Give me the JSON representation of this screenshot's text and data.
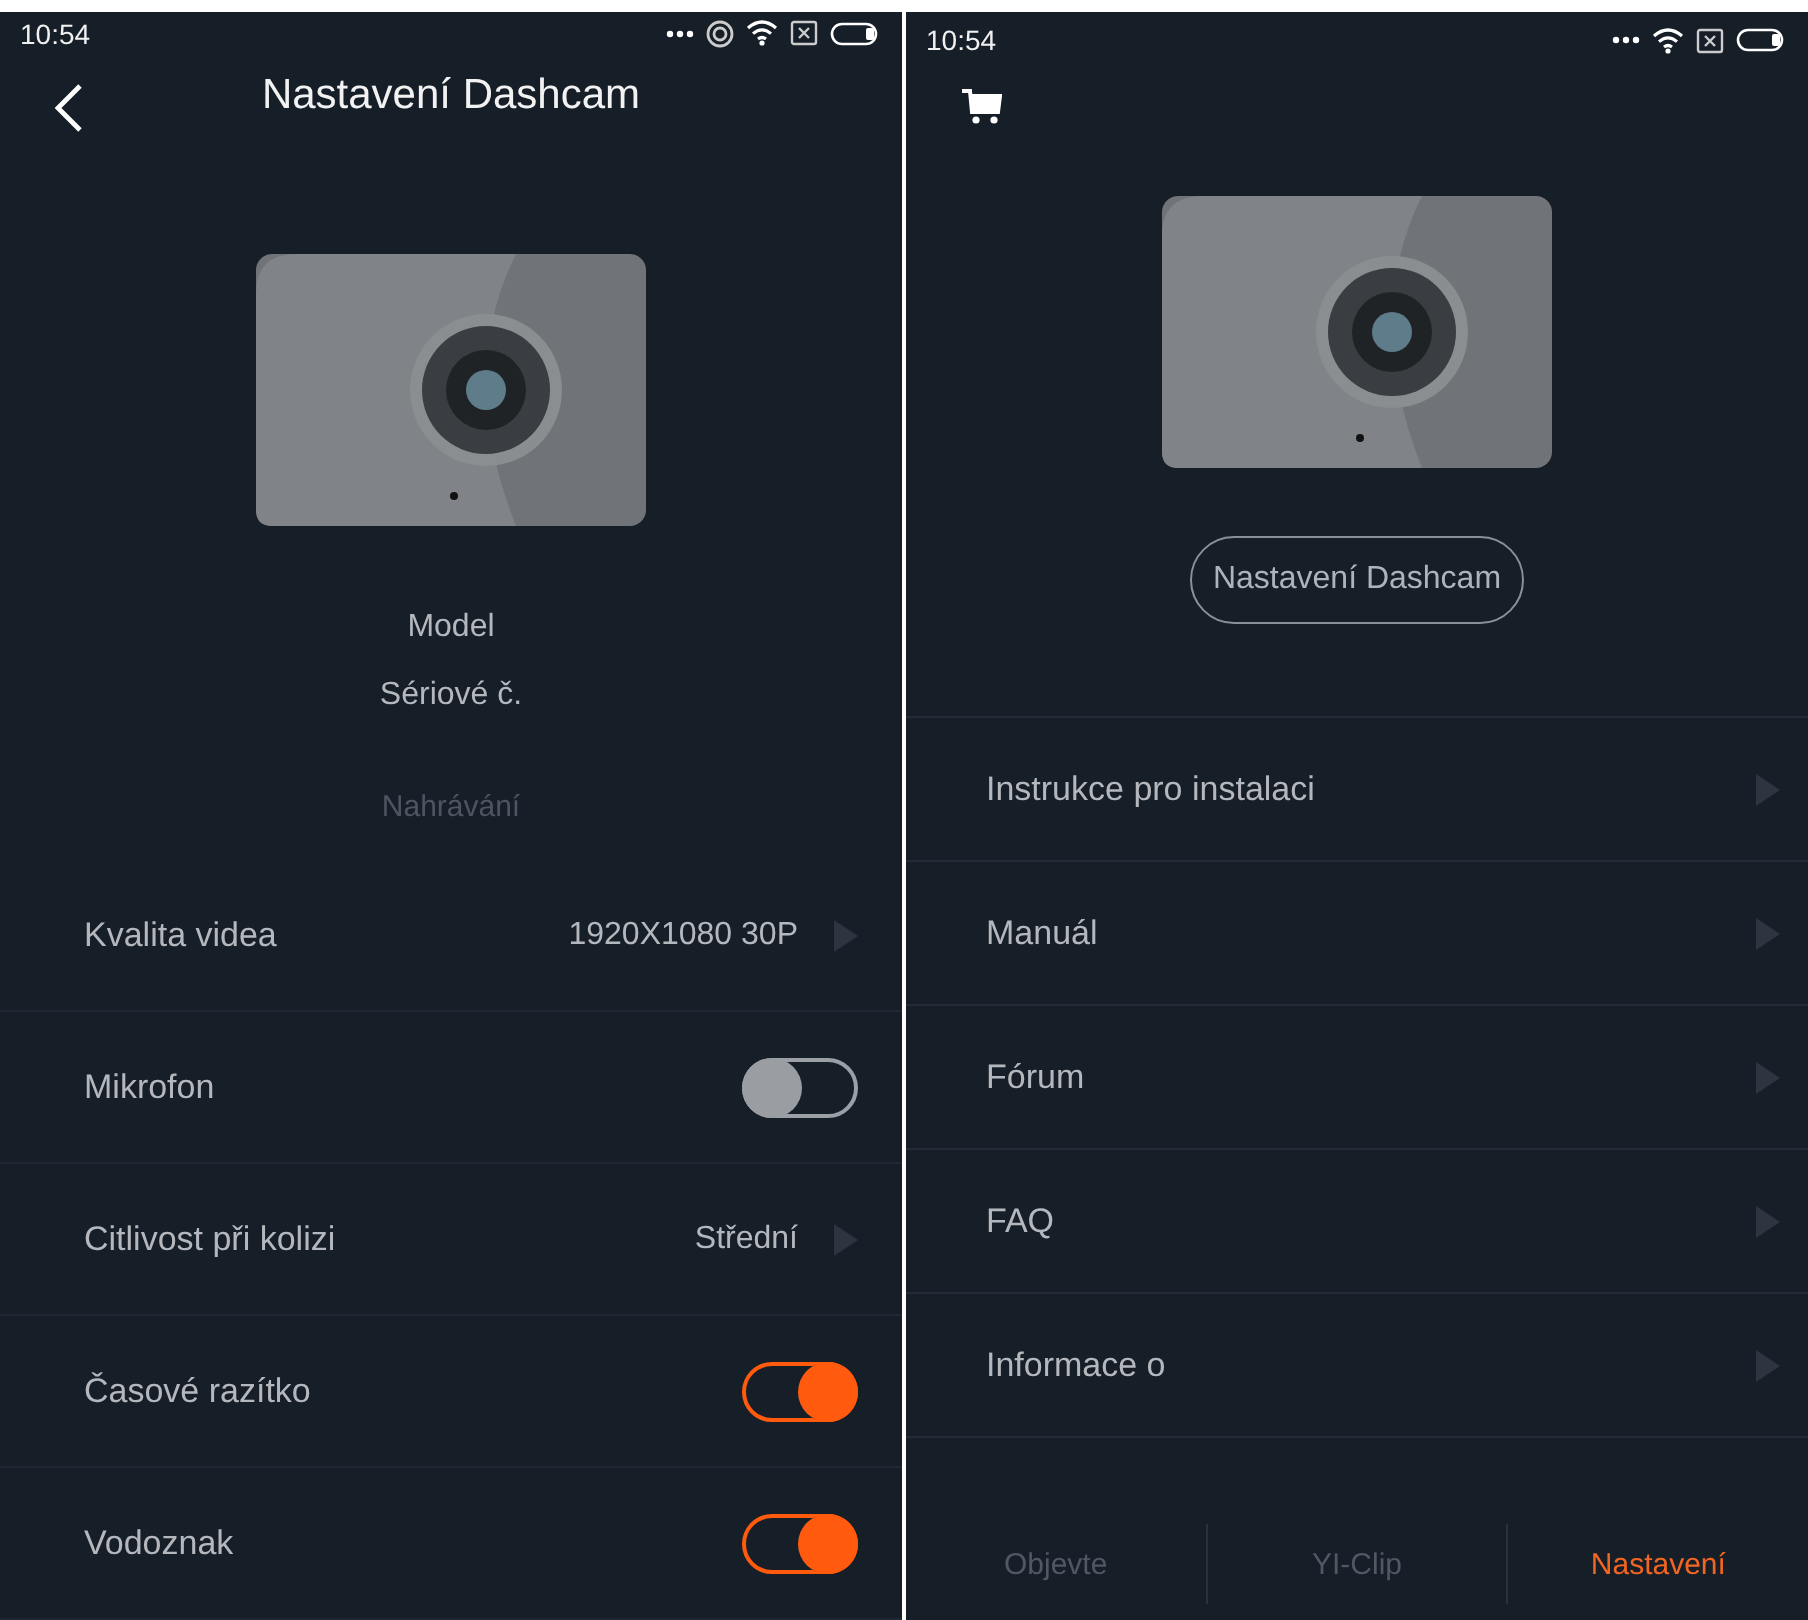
{
  "left_screen": {
    "status_bar": {
      "time": "10:54"
    },
    "title": "Nastavení Dashcam",
    "info": [
      "Model",
      "Sériové č."
    ],
    "section": "Nahrávání",
    "settings": [
      {
        "kind": "value",
        "label": "Kvalita videa",
        "value": "1920X1080 30P"
      },
      {
        "kind": "toggle",
        "label": "Mikrofon",
        "on": false
      },
      {
        "kind": "value",
        "label": "Citlivost při kolizi",
        "value": "Střední"
      },
      {
        "kind": "toggle",
        "label": "Časové razítko",
        "on": true
      },
      {
        "kind": "toggle",
        "label": "Vodoznak",
        "on": true
      }
    ]
  },
  "right_screen": {
    "status_bar": {
      "time": "10:54"
    },
    "device_button": "Nastavení Dashcam",
    "menu": [
      "Instrukce pro instalaci",
      "Manuál",
      "Fórum",
      "FAQ",
      "Informace o"
    ],
    "tabs": [
      {
        "label": "Objevte",
        "selected": false
      },
      {
        "label": "YI-Clip",
        "selected": false
      },
      {
        "label": "Nastavení",
        "selected": true
      }
    ]
  }
}
